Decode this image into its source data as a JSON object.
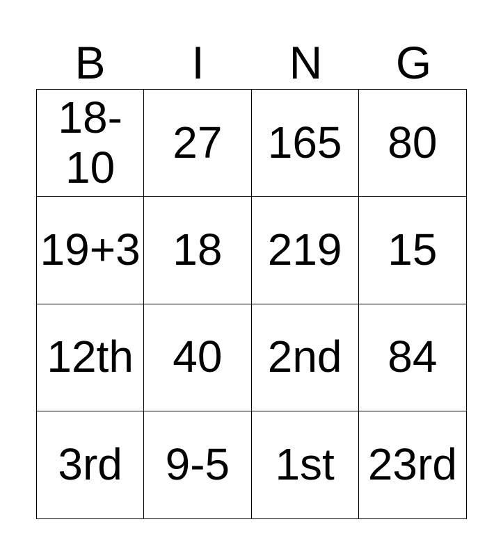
{
  "header": [
    "B",
    "I",
    "N",
    "G"
  ],
  "cells": [
    [
      "18-\n10",
      "27",
      "165",
      "80"
    ],
    [
      "19+3",
      "18",
      "219",
      "15"
    ],
    [
      "12th",
      "40",
      "2nd",
      "84"
    ],
    [
      "3rd",
      "9-5",
      "1st",
      "23rd"
    ]
  ]
}
